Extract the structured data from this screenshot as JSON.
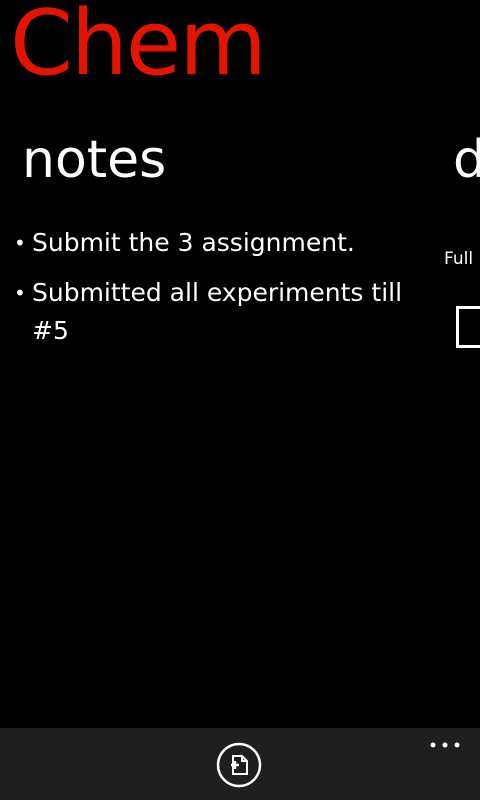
{
  "app": {
    "title": "Chem",
    "accent_color": "#e51400"
  },
  "pivot": {
    "current_header": "notes",
    "next_header_peek": "d"
  },
  "notes": [
    {
      "text": "Submit the 3 assignment."
    },
    {
      "text": "Submitted all experiments till #5"
    }
  ],
  "peek": {
    "label": "Full"
  },
  "app_bar": {
    "background": "#1f1f1f",
    "buttons": [
      {
        "icon": "add-note-icon"
      }
    ],
    "more_icon": "ellipsis-icon"
  }
}
